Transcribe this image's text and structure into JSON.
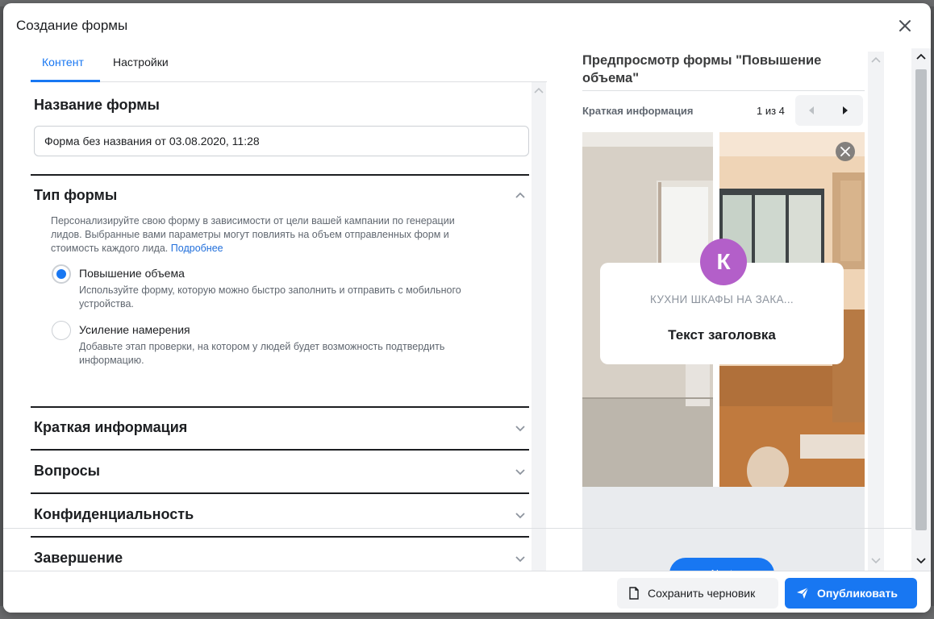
{
  "modal": {
    "title": "Создание формы"
  },
  "tabs": [
    {
      "label": "Контент",
      "active": true
    },
    {
      "label": "Настройки",
      "active": false
    }
  ],
  "form_name": {
    "heading": "Название формы",
    "value": "Форма без названия от 03.08.2020, 11:28"
  },
  "form_type": {
    "heading": "Тип формы",
    "description": "Персонализируйте свою форму в зависимости от цели вашей кампании по генерации лидов. Выбранные вами параметры могут повлиять на объем отправленных форм и стоимость каждого лида.",
    "learn_more": "Подробнее",
    "options": [
      {
        "label": "Повышение объема",
        "help": "Используйте форму, которую можно быстро заполнить и отправить с мобильного устройства.",
        "selected": true
      },
      {
        "label": "Усиление намерения",
        "help": "Добавьте этап проверки, на котором у людей будет возможность подтвердить информацию.",
        "selected": false
      }
    ]
  },
  "sections": [
    {
      "heading": "Краткая информация"
    },
    {
      "heading": "Вопросы"
    },
    {
      "heading": "Конфиденциальность"
    },
    {
      "heading": "Завершение"
    }
  ],
  "preview": {
    "title": "Предпросмотр формы \"Повышение объема\"",
    "nav_label": "Краткая информация",
    "page_indicator": "1 из 4",
    "avatar_letter": "К",
    "card_subtitle": "КУХНИ ШКАФЫ НА ЗАКА...",
    "card_headline": "Текст заголовка",
    "next_button": "Next"
  },
  "footer": {
    "save_draft": "Сохранить черновик",
    "publish": "Опубликовать"
  },
  "colors": {
    "accent": "#1877f2",
    "avatar": "#b35fc9",
    "link": "#216fdb"
  }
}
